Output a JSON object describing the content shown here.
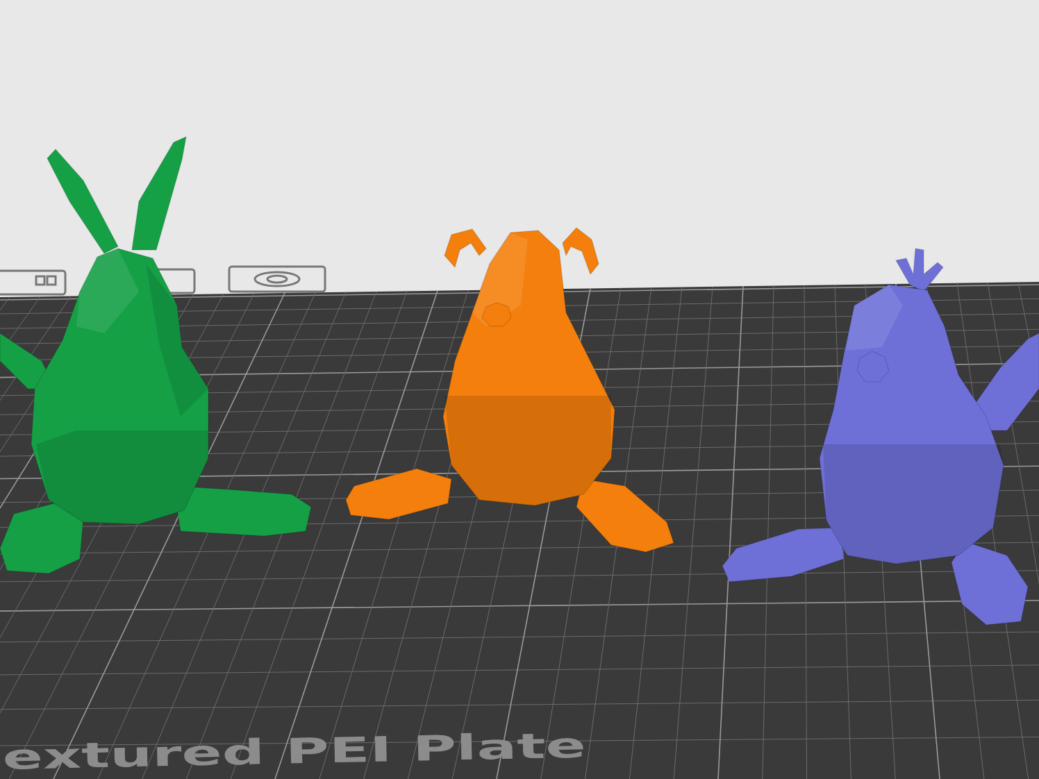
{
  "plate": {
    "label": "extured PEI Plate"
  },
  "models": [
    {
      "color": "#15a046"
    },
    {
      "color": "#f47f0c"
    },
    {
      "color": "#6e70d8"
    }
  ]
}
